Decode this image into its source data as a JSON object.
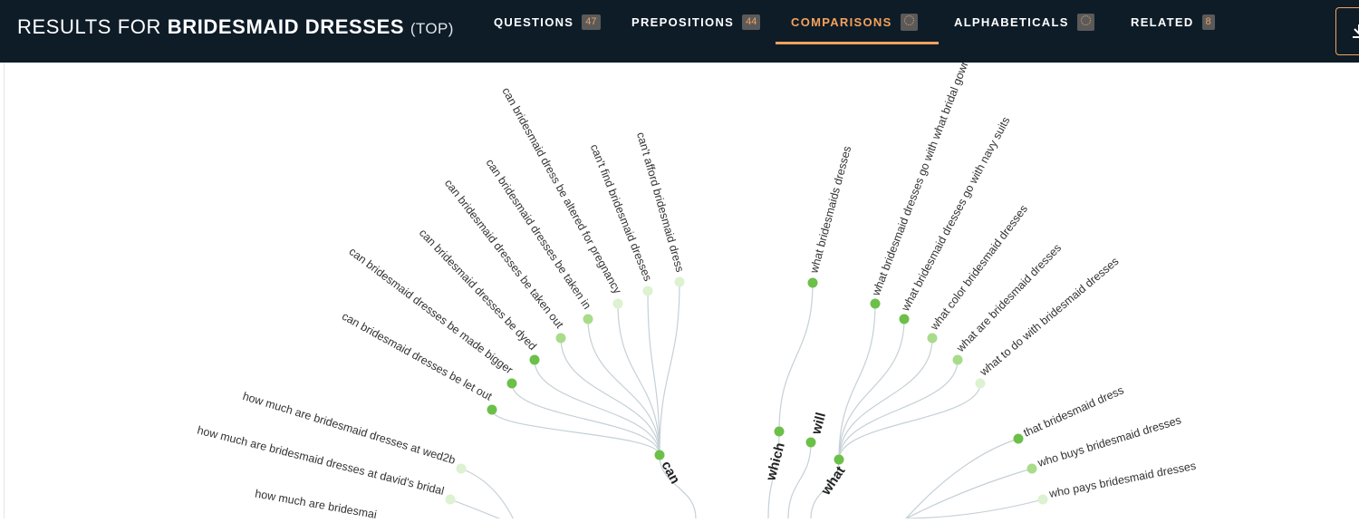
{
  "header": {
    "title_prefix": "RESULTS FOR",
    "keyword": "BRIDESMAID DRESSES",
    "mode": "(TOP)"
  },
  "tabs": [
    {
      "label": "QUESTIONS",
      "count": "47",
      "active": false
    },
    {
      "label": "PREPOSITIONS",
      "count": "44",
      "active": false
    },
    {
      "label": "COMPARISONS",
      "count": "",
      "loading": true,
      "active": true
    },
    {
      "label": "ALPHABETICALS",
      "count": "",
      "loading": true,
      "active": false
    },
    {
      "label": "RELATED",
      "count": "8",
      "active": false
    }
  ],
  "download_icon": "download-icon",
  "colors": {
    "header_bg": "#0e1c28",
    "accent": "#f5a25b",
    "node_dark": "#6cc04a",
    "node_mid": "#a8dc8a",
    "node_light": "#dcf2d0",
    "link": "#c5d0d6"
  },
  "wheel": {
    "hubs": [
      "can",
      "which",
      "will",
      "what"
    ],
    "can_items": [
      "can't afford bridesmaid dress",
      "can't find bridesmaid dresses",
      "can bridesmaid dress be altered for pregnancy",
      "can bridesmaid dresses be taken in",
      "can bridesmaid dresses be taken out",
      "can bridesmaid dresses be dyed",
      "can bridesmaid dresses be made bigger",
      "can bridesmaid dresses be let out"
    ],
    "which_items": [
      "what bridesmaids dresses"
    ],
    "what_items": [
      "what bridesmaid dresses go with what bridal gown",
      "what bridesmaid dresses go with navy suits",
      "what color bridesmaid dresses",
      "what are bridesmaid dresses",
      "what to do with bridesmaid dresses"
    ],
    "how_items": [
      "how much are bridesmaid dresses at wed2b",
      "how much are bridesmaid dresses at david's bridal",
      "how much are bridesmai"
    ],
    "who_items": [
      "that bridesmaid dress",
      "who buys bridesmaid dresses",
      "who pays bridesmaid dresses"
    ]
  }
}
